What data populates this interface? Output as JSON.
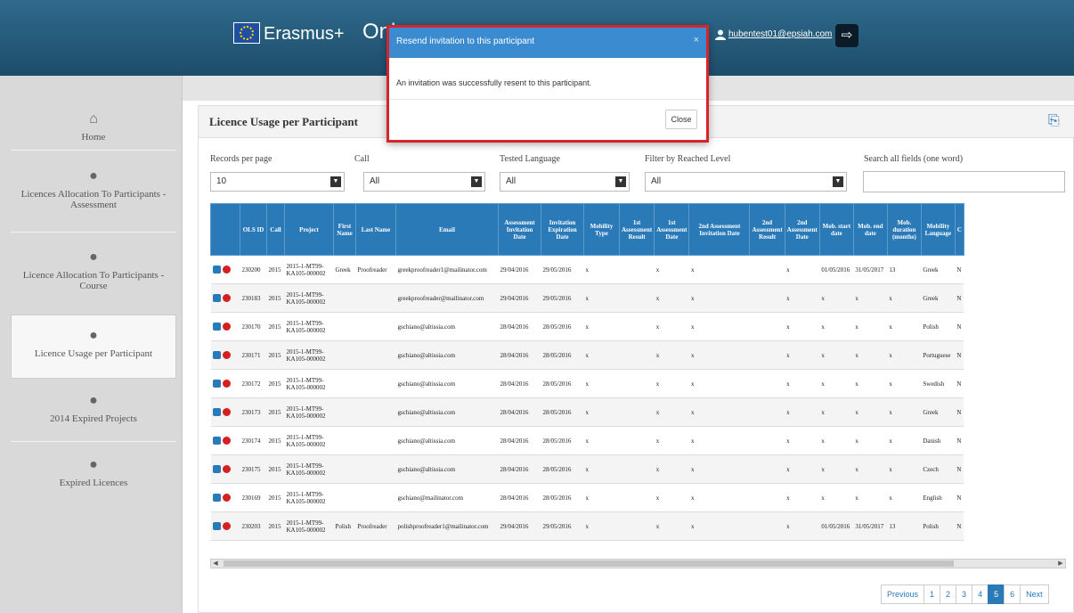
{
  "header": {
    "brand": "Erasmus+",
    "app_name": "Onl",
    "user_email": "hubentest01@epsiah.com",
    "user_icon": "user-icon",
    "logout_icon": "logout-icon"
  },
  "sidebar": {
    "items": [
      {
        "label": "Home",
        "icon": "home-icon"
      },
      {
        "label": "Licences Allocation To Participants - Assessment",
        "icon": "pin-icon"
      },
      {
        "label": "Licence Allocation To Participants - Course",
        "icon": "pin-icon"
      },
      {
        "label": "Licence Usage per Participant",
        "icon": "pin-icon",
        "active": true
      },
      {
        "label": "2014 Expired Projects",
        "icon": "pin-icon"
      },
      {
        "label": "Expired Licences",
        "icon": "pin-icon"
      }
    ]
  },
  "panel": {
    "title": "Licence Usage per Participant",
    "export_icon": "export-icon"
  },
  "filters": {
    "records_per_page": {
      "label": "Records per page",
      "value": "10"
    },
    "call": {
      "label": "Call",
      "value": "All"
    },
    "tested_language": {
      "label": "Tested Language",
      "value": "All"
    },
    "reached_level": {
      "label": "Filter by Reached Level",
      "value": "All"
    },
    "search": {
      "label": "Search all fields (one word)",
      "value": ""
    }
  },
  "table": {
    "columns": [
      "",
      "OLS ID",
      "Call",
      "Project",
      "First Name",
      "Last Name",
      "Email",
      "Assessment Invitation Date",
      "Invitation Expiration Date",
      "Mobility Type",
      "1st Assessment Result",
      "1st Assessment Date",
      "2nd Assessment Invitation Date",
      "2nd Assessment Result",
      "2nd Assessment Date",
      "Mob. start date",
      "Mob. end date",
      "Mob. duration (months)",
      "Mobility Language",
      "C"
    ],
    "rows": [
      [
        "230200",
        "2015",
        "2015-1-MT99-KA105-000002",
        "Greek",
        "Proofreader",
        "greekproofreader1@mailinator.com",
        "29/04/2016",
        "29/05/2016",
        "x",
        "",
        "x",
        "x",
        "",
        "x",
        "01/05/2016",
        "31/05/2017",
        "13",
        "Greek",
        "N"
      ],
      [
        "230183",
        "2015",
        "2015-1-MT99-KA105-000002",
        "",
        "",
        "greekproofreader@mailinator.com",
        "29/04/2016",
        "29/05/2016",
        "x",
        "",
        "x",
        "x",
        "",
        "x",
        "x",
        "x",
        "x",
        "Greek",
        "N"
      ],
      [
        "230170",
        "2015",
        "2015-1-MT99-KA105-000002",
        "",
        "",
        "gschiano@altissia.com",
        "28/04/2016",
        "28/05/2016",
        "x",
        "",
        "x",
        "x",
        "",
        "x",
        "x",
        "x",
        "x",
        "Polish",
        "N"
      ],
      [
        "230171",
        "2015",
        "2015-1-MT99-KA105-000002",
        "",
        "",
        "gschiano@altissia.com",
        "28/04/2016",
        "28/05/2016",
        "x",
        "",
        "x",
        "x",
        "",
        "x",
        "x",
        "x",
        "x",
        "Portuguese",
        "N"
      ],
      [
        "230172",
        "2015",
        "2015-1-MT99-KA105-000002",
        "",
        "",
        "gschiano@altissia.com",
        "28/04/2016",
        "28/05/2016",
        "x",
        "",
        "x",
        "x",
        "",
        "x",
        "x",
        "x",
        "x",
        "Swedish",
        "N"
      ],
      [
        "230173",
        "2015",
        "2015-1-MT99-KA105-000002",
        "",
        "",
        "gschiano@altissia.com",
        "28/04/2016",
        "28/05/2016",
        "x",
        "",
        "x",
        "x",
        "",
        "x",
        "x",
        "x",
        "x",
        "Greek",
        "N"
      ],
      [
        "230174",
        "2015",
        "2015-1-MT99-KA105-000002",
        "",
        "",
        "gschiano@altissia.com",
        "28/04/2016",
        "28/05/2016",
        "x",
        "",
        "x",
        "x",
        "",
        "x",
        "x",
        "x",
        "x",
        "Danish",
        "N"
      ],
      [
        "230175",
        "2015",
        "2015-1-MT99-KA105-000002",
        "",
        "",
        "gschiano@altissia.com",
        "28/04/2016",
        "28/05/2016",
        "x",
        "",
        "x",
        "x",
        "",
        "x",
        "x",
        "x",
        "x",
        "Czech",
        "N"
      ],
      [
        "230169",
        "2015",
        "2015-1-MT99-KA105-000002",
        "",
        "",
        "gschiano@mailinator.com",
        "28/04/2016",
        "28/05/2016",
        "x",
        "",
        "x",
        "x",
        "",
        "x",
        "x",
        "x",
        "x",
        "English",
        "N"
      ],
      [
        "230203",
        "2015",
        "2015-1-MT99-KA105-000002",
        "Polish",
        "Proofreader",
        "polishproofreader1@mailinator.com",
        "29/04/2016",
        "29/05/2016",
        "x",
        "",
        "x",
        "x",
        "",
        "x",
        "01/05/2016",
        "31/05/2017",
        "13",
        "Polish",
        "N"
      ]
    ]
  },
  "pagination": {
    "previous": "Previous",
    "pages": [
      "1",
      "2",
      "3",
      "4",
      "5",
      "6"
    ],
    "active": "5",
    "next": "Next"
  },
  "modal": {
    "title": "Resend invitation to this participant",
    "close_x": "×",
    "message": "An invitation was successfully resent to this participant.",
    "close_button": "Close"
  },
  "colors": {
    "header_bg": "#1d4d6a",
    "table_header": "#2a7ab8",
    "modal_header": "#3a8bd0",
    "highlight_border": "#d9232a",
    "delete_red": "#d62020"
  }
}
